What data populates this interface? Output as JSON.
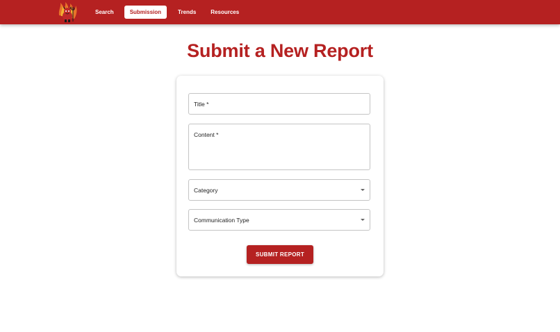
{
  "navbar": {
    "logo_icon": "devil-mascot-icon",
    "brand_color": "#b52121",
    "links": [
      {
        "label": "Search",
        "active": false
      },
      {
        "label": "Submission",
        "active": true
      },
      {
        "label": "Trends",
        "active": false
      },
      {
        "label": "Resources",
        "active": false
      }
    ]
  },
  "page": {
    "title": "Submit a New Report"
  },
  "form": {
    "title_label": "Title *",
    "content_label": "Content *",
    "category_label": "Category",
    "comm_type_label": "Communication Type",
    "submit_label": "SUBMIT REPORT"
  }
}
